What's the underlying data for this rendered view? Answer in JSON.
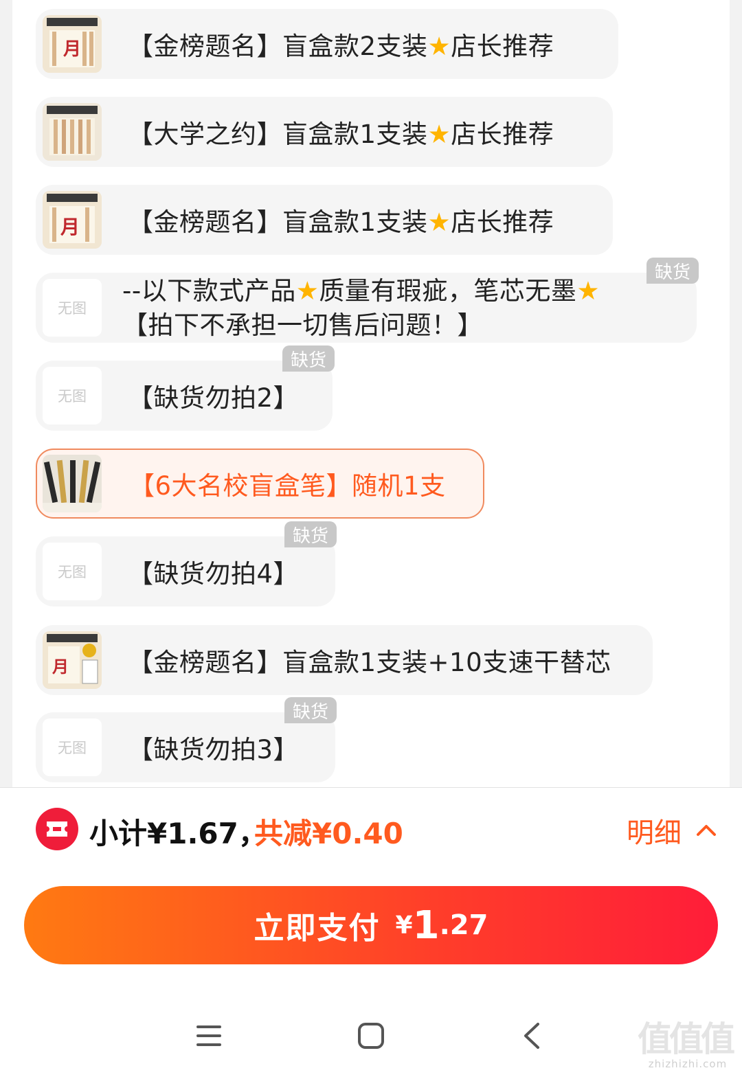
{
  "options": [
    {
      "text_a": "【金榜题名】盲盒款2支装",
      "text_b": "店长推荐",
      "thumb": "product-image"
    },
    {
      "text_a": "【大学之约】盲盒款1支装",
      "text_b": "店长推荐",
      "thumb": "product-image"
    },
    {
      "text_a": "【金榜题名】盲盒款1支装",
      "text_b": "店长推荐",
      "thumb": "product-image"
    },
    {
      "line1_a": "--以下款式产品",
      "line1_b": "质量有瑕疵，笔芯无墨",
      "line2": "【拍下不承担一切售后问题！】",
      "thumb_text": "无图",
      "badge": "缺货"
    },
    {
      "text": "【缺货勿拍2】",
      "thumb_text": "无图",
      "badge": "缺货"
    },
    {
      "text": "【6大名校盲盒笔】随机1支",
      "selected": true,
      "thumb": "product-image"
    },
    {
      "text": "【缺货勿拍4】",
      "thumb_text": "无图",
      "badge": "缺货"
    },
    {
      "text": "【金榜题名】盲盒款1支装+10支速干替芯",
      "thumb": "product-image"
    },
    {
      "text": "【缺货勿拍3】",
      "thumb_text": "无图",
      "badge": "缺货"
    }
  ],
  "star_icon": "star-emoji",
  "footer": {
    "subtotal": "小计¥1.67，",
    "discount": "共减¥0.40",
    "detail_label": "明细",
    "pay_label": "立即支付",
    "pay_symbol": "¥",
    "pay_integer": "1",
    "pay_decimal": ".27"
  },
  "watermark": {
    "big": "值值值",
    "small": "zhizhizhi.com"
  },
  "colors": {
    "accent": "#ff5a1f",
    "pay_start": "#ff7a12",
    "pay_end": "#ff1d39",
    "coupon": "#ef1d3a",
    "badge": "#c8c8c8"
  }
}
